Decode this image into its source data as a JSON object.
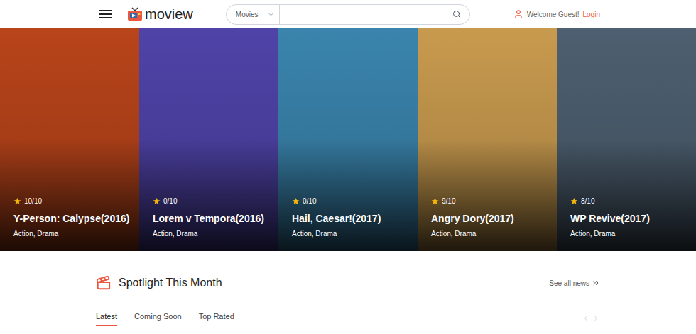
{
  "header": {
    "logo": "moview",
    "search": {
      "category": "Movies",
      "placeholder": ""
    },
    "welcome": "Welcome Guest!",
    "login": "Login"
  },
  "movies": [
    {
      "rating": "10/10",
      "title": "Y-Person: Calypse(2016)",
      "genres": "Action, Drama",
      "color": "#b8441a"
    },
    {
      "rating": "0/10",
      "title": "Lorem v Tempora(2016)",
      "genres": "Action, Drama",
      "color": "#4f43a8"
    },
    {
      "rating": "0/10",
      "title": "Hail, Caesar!(2017)",
      "genres": "Action, Drama",
      "color": "#3a84ad"
    },
    {
      "rating": "9/10",
      "title": "Angry Dory(2017)",
      "genres": "Action, Drama",
      "color": "#c89a4e"
    },
    {
      "rating": "8/10",
      "title": "WP Revive(2017)",
      "genres": "Action, Drama",
      "color": "#4d5f70"
    }
  ],
  "spotlight": {
    "title": "Spotlight This Month",
    "see_all": "See all news",
    "tabs": [
      {
        "label": "Latest",
        "selected": true
      },
      {
        "label": "Coming Soon",
        "selected": false
      },
      {
        "label": "Top Rated",
        "selected": false
      }
    ]
  }
}
